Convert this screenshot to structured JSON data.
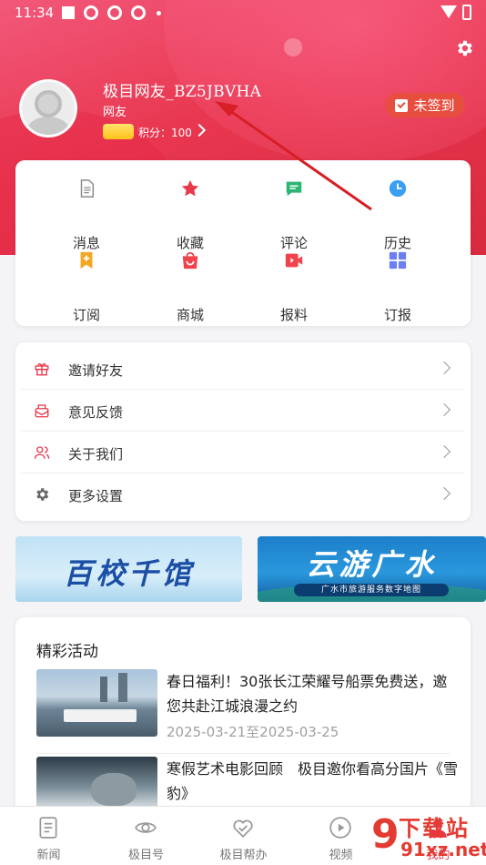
{
  "status_bar": {
    "time": "11:34"
  },
  "profile": {
    "username": "极目网友_BZ5JBVHA",
    "user_type": "网友",
    "points_label": "积分：100",
    "signin_label": "未签到"
  },
  "grid": {
    "items": [
      {
        "label": "消息",
        "icon": "message-icon",
        "color": "#8a8a8a"
      },
      {
        "label": "收藏",
        "icon": "star-icon",
        "color": "#e8394a"
      },
      {
        "label": "评论",
        "icon": "comment-icon",
        "color": "#2bb673"
      },
      {
        "label": "历史",
        "icon": "clock-icon",
        "color": "#3a9ff0"
      },
      {
        "label": "订阅",
        "icon": "bookmark-add-icon",
        "color": "#f5a623"
      },
      {
        "label": "商城",
        "icon": "shopping-bag-icon",
        "color": "#f0434d"
      },
      {
        "label": "报料",
        "icon": "video-icon",
        "color": "#f0434d"
      },
      {
        "label": "订报",
        "icon": "grid-icon",
        "color": "#6b7ff0"
      }
    ]
  },
  "list": {
    "items": [
      {
        "label": "邀请好友",
        "icon": "gift-icon",
        "color": "#e8394a"
      },
      {
        "label": "意见反馈",
        "icon": "feedback-icon",
        "color": "#e8394a"
      },
      {
        "label": "关于我们",
        "icon": "users-icon",
        "color": "#e8394a"
      },
      {
        "label": "更多设置",
        "icon": "gear-icon",
        "color": "#666666"
      }
    ]
  },
  "banners": [
    {
      "title": "百校千馆"
    },
    {
      "title": "云游广水",
      "subtitle": "广水市旅游服务数字地图"
    }
  ],
  "activities": {
    "title": "精彩活动",
    "items": [
      {
        "text": "春日福利！30张长江荣耀号船票免费送，邀您共赴江城浪漫之约",
        "date": "2025-03-21至2025-03-25"
      },
      {
        "text": "寒假艺术电影回顾　极目邀你看高分国片《雪豹》",
        "date": ""
      }
    ]
  },
  "tabbar": {
    "items": [
      {
        "label": "新闻",
        "icon": "news-icon"
      },
      {
        "label": "极目号",
        "icon": "eye-icon"
      },
      {
        "label": "极目帮办",
        "icon": "heart-hands-icon"
      },
      {
        "label": "视频",
        "icon": "play-icon"
      },
      {
        "label": "我的",
        "icon": "user-icon"
      }
    ]
  },
  "watermark": {
    "line1": "下载站",
    "line2": "91xz.net"
  },
  "colors": {
    "brand": "#e8374f",
    "annotation_arrow": "#d61f26"
  }
}
